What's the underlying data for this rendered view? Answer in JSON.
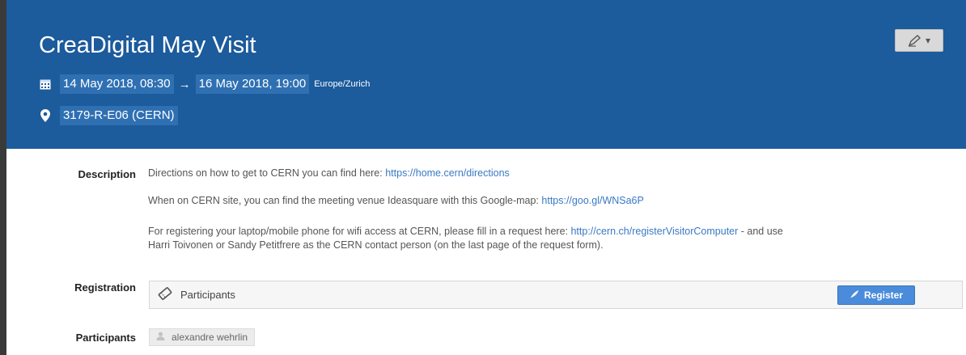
{
  "event": {
    "title": "CreaDigital May Visit",
    "start": "14 May 2018, 08:30",
    "arrow": "→",
    "end": "16 May 2018, 19:00",
    "timezone": "Europe/Zurich",
    "location": "3179-R-E06 (CERN)"
  },
  "description": {
    "label": "Description",
    "p1_text": "Directions on how to get to CERN you can find here: ",
    "p1_link": "https://home.cern/directions",
    "p2_text": "When on CERN site, you can find the meeting venue Ideasquare with this Google-map: ",
    "p2_link": "https://goo.gl/WNSa6P",
    "p3_text_a": "For registering your laptop/mobile phone for wifi access at CERN, please fill in a request here: ",
    "p3_link": "http://cern.ch/registerVisitorComputer",
    "p3_text_b": " - and use",
    "p3_line2": "Harri Toivonen or Sandy Petitfrere as the CERN contact person (on the last page of the request form)."
  },
  "registration": {
    "label": "Registration",
    "form_name": "Participants",
    "button": "Register"
  },
  "participants": {
    "label": "Participants",
    "items": [
      "alexandre wehrlin"
    ]
  },
  "colors": {
    "header_bg": "#1c5b9c",
    "highlight_bg": "#2f70b3",
    "link": "#3a79c4",
    "register_button": "#4a8cdb"
  },
  "icons": {
    "edit": "pen-icon",
    "date": "calendar-icon",
    "location": "map-marker-icon",
    "registration": "ticket-icon",
    "register_button": "feather-icon",
    "participant": "user-icon"
  }
}
